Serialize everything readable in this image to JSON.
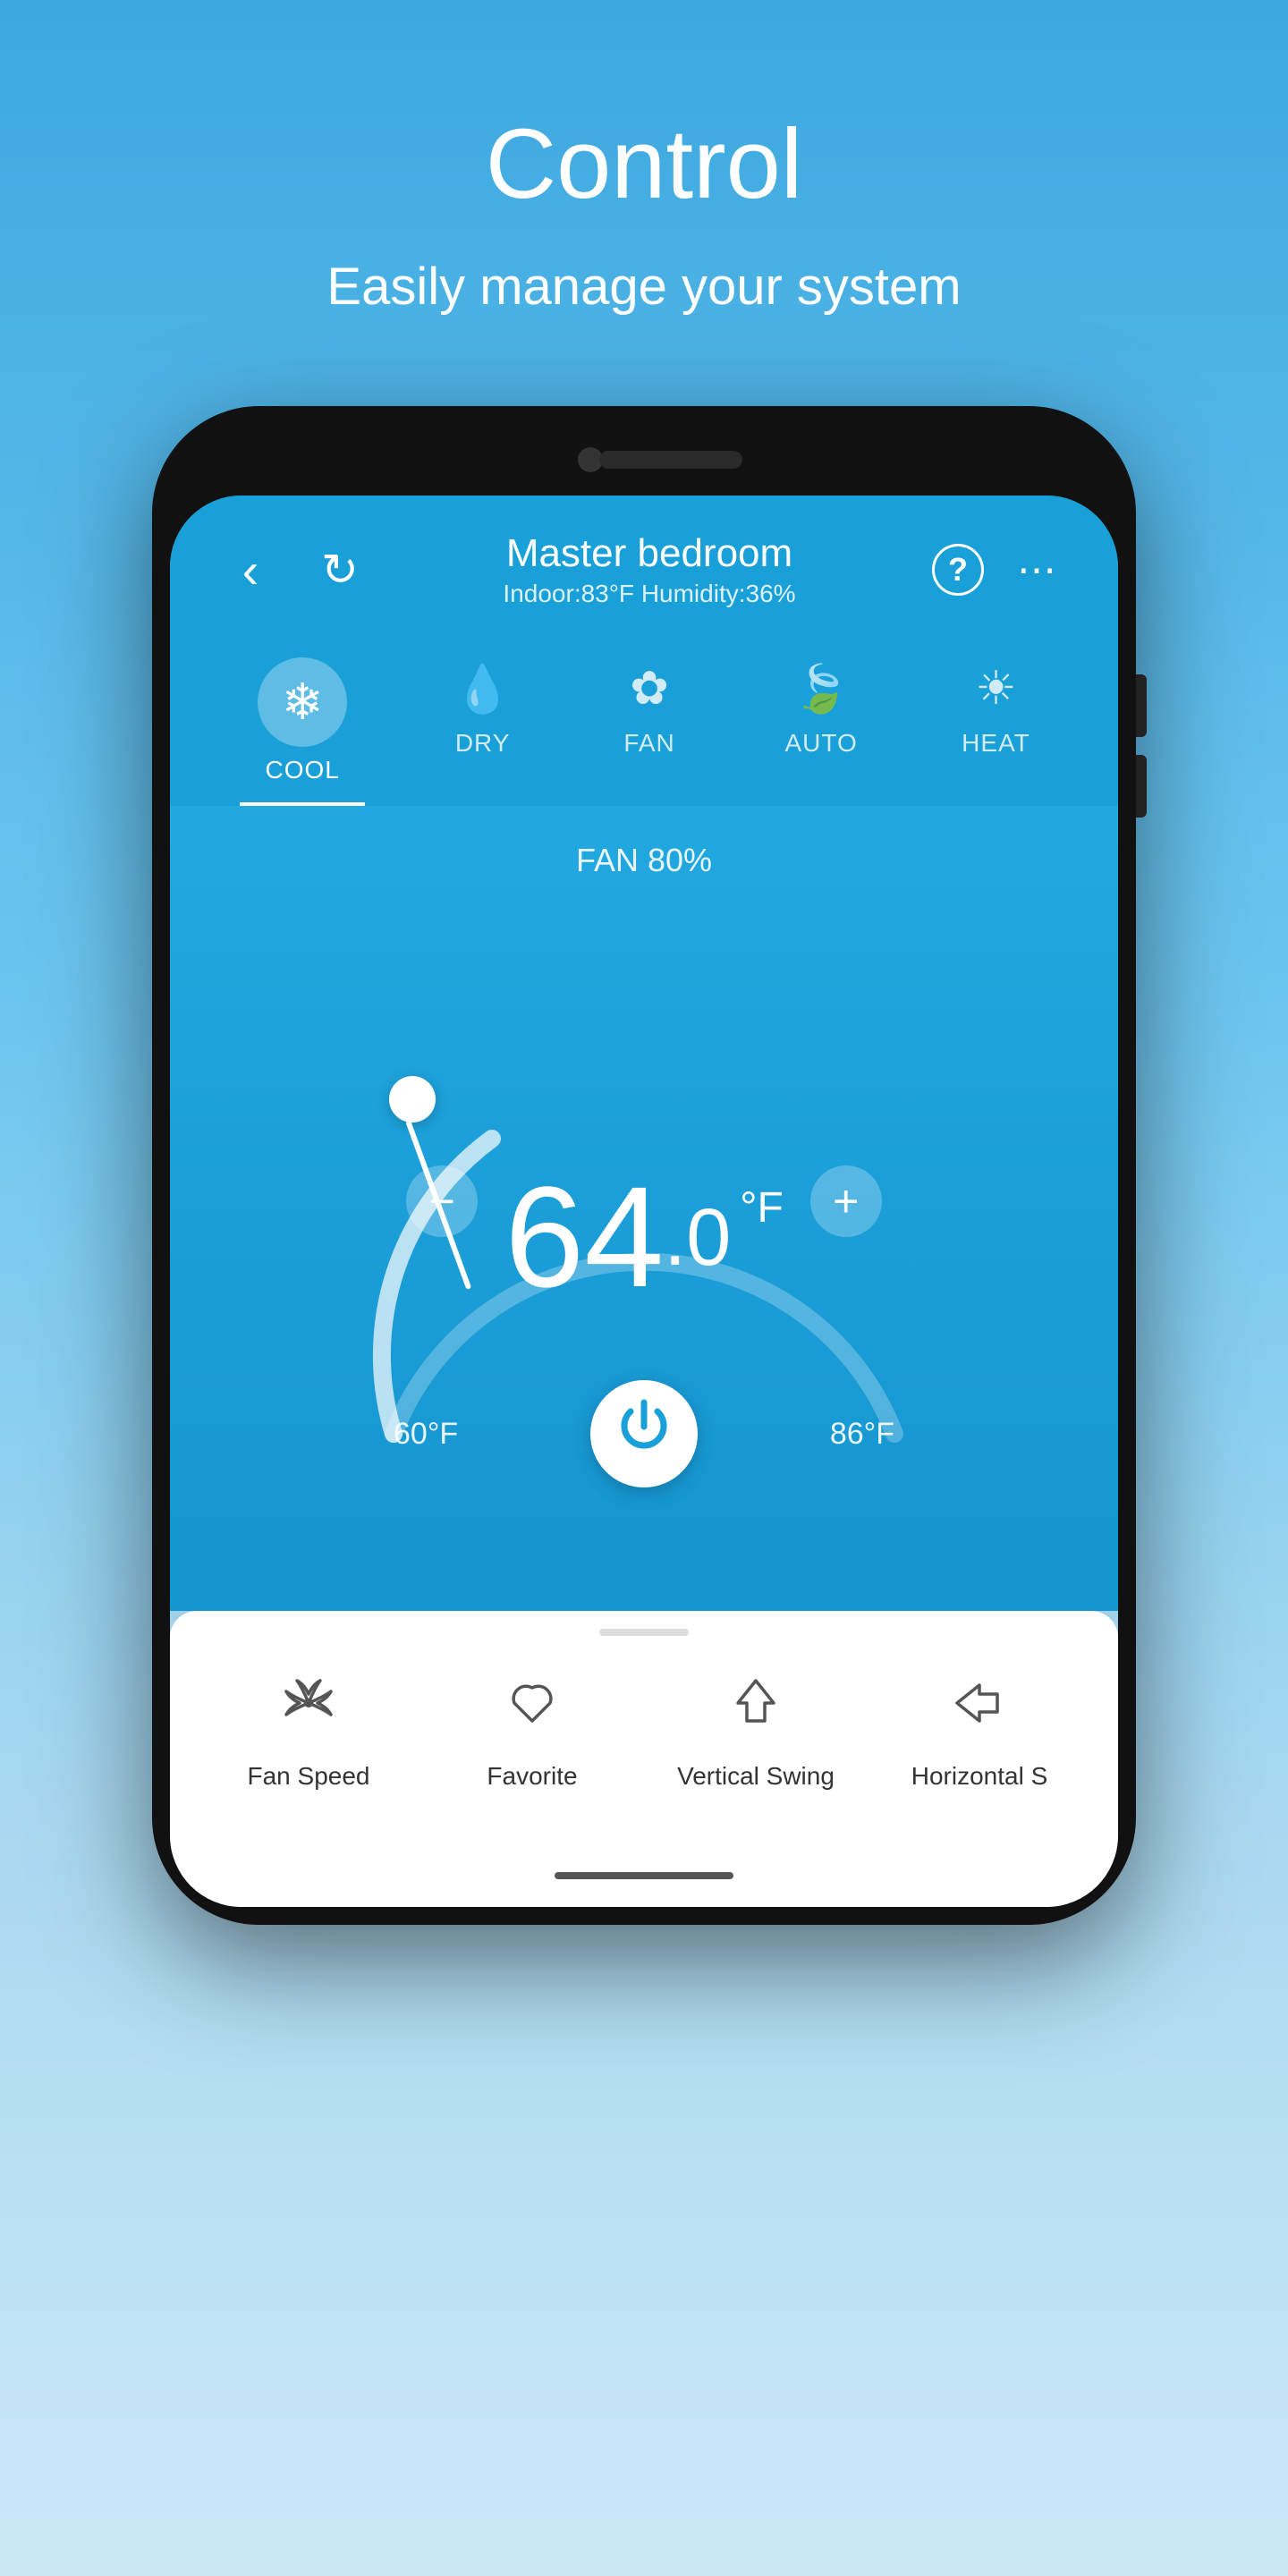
{
  "page": {
    "title": "Control",
    "subtitle": "Easily manage your system"
  },
  "app": {
    "back_icon": "‹",
    "refresh_icon": "↻",
    "room_name": "Master bedroom",
    "indoor_info": "Indoor:83°F  Humidity:36%",
    "help_icon": "?",
    "more_icon": "⋯"
  },
  "modes": [
    {
      "id": "cool",
      "label": "COOL",
      "icon": "❄",
      "active": true
    },
    {
      "id": "dry",
      "label": "DRY",
      "icon": "💧",
      "active": false
    },
    {
      "id": "fan",
      "label": "FAN",
      "icon": "✿",
      "active": false
    },
    {
      "id": "auto",
      "label": "AUTO",
      "icon": "🍃",
      "active": false
    },
    {
      "id": "heat",
      "label": "HEAT",
      "icon": "☀",
      "active": false
    }
  ],
  "thermostat": {
    "fan_label": "FAN 80%",
    "temperature": "64",
    "temperature_decimal": ".0",
    "unit": "°F",
    "temp_min": "60°F",
    "temp_max": "86°F",
    "minus_label": "−",
    "plus_label": "+"
  },
  "bottom_actions": [
    {
      "id": "fan_speed",
      "label": "Fan Speed",
      "icon": "❃"
    },
    {
      "id": "favorite",
      "label": "Favorite",
      "icon": "♡"
    },
    {
      "id": "vertical_swing",
      "label": "Vertical Swing",
      "icon": "⬡"
    },
    {
      "id": "horizontal_swing",
      "label": "Horizontal S",
      "icon": "◇"
    }
  ]
}
